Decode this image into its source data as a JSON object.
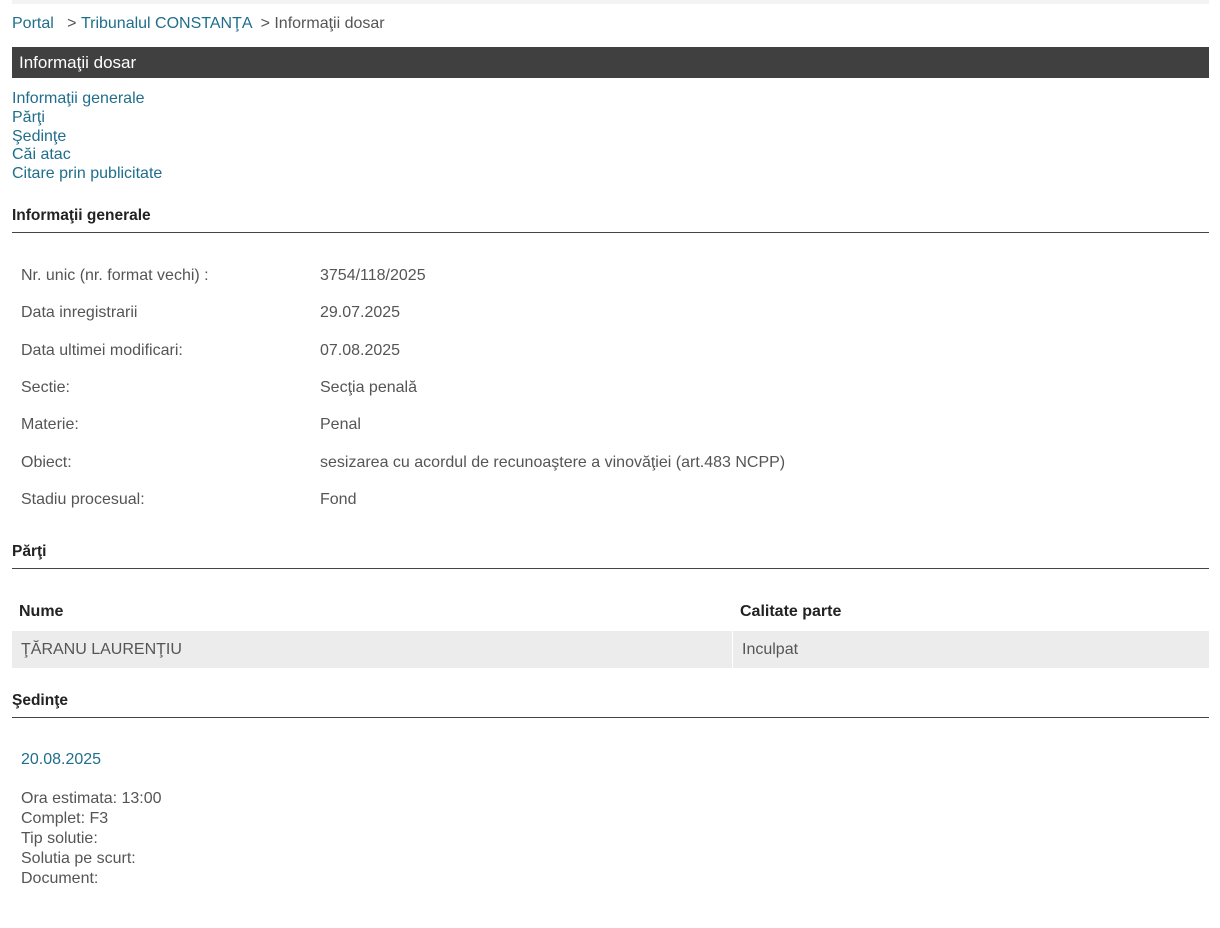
{
  "breadcrumb": {
    "portal": "Portal",
    "separator1": ">",
    "court": "Tribunalul CONSTANŢA",
    "separator2": ">",
    "current": "Informaţii dosar"
  },
  "page_title": "Informaţii dosar",
  "toc": [
    "Informaţii generale",
    "Părţi",
    "Şedinţe",
    "Căi atac",
    "Citare prin publicitate"
  ],
  "general": {
    "heading": "Informaţii generale",
    "rows": [
      {
        "label": "Nr. unic (nr. format vechi) :",
        "value": "3754/118/2025"
      },
      {
        "label": "Data inregistrarii",
        "value": "29.07.2025"
      },
      {
        "label": "Data ultimei modificari:",
        "value": "07.08.2025"
      },
      {
        "label": "Sectie:",
        "value": "Secţia penală"
      },
      {
        "label": "Materie:",
        "value": "Penal"
      },
      {
        "label": "Obiect:",
        "value": "sesizarea cu acordul de recunoaştere a vinovăţiei (art.483 NCPP)"
      },
      {
        "label": "Stadiu procesual:",
        "value": "Fond"
      }
    ]
  },
  "parties": {
    "heading": "Părţi",
    "columns": [
      "Nume",
      "Calitate parte"
    ],
    "rows": [
      [
        "ŢĂRANU LAURENŢIU",
        "Inculpat"
      ]
    ]
  },
  "hearings": {
    "heading": "Şedinţe",
    "date": "20.08.2025",
    "details": [
      "Ora estimata: 13:00",
      "Complet: F3",
      "Tip solutie:",
      "Solutia pe scurt:",
      "Document:"
    ]
  }
}
